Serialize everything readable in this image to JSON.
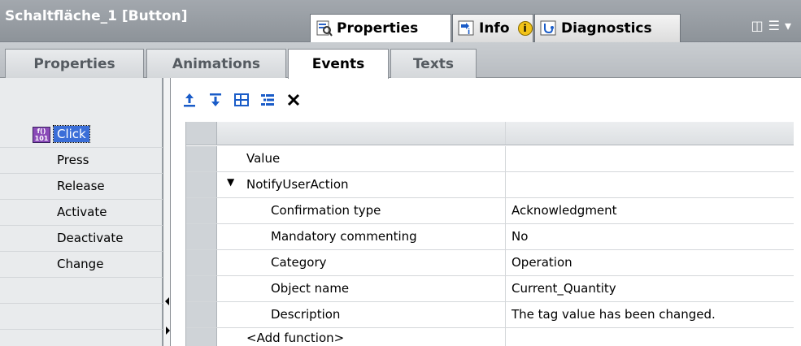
{
  "header": {
    "title": "Schaltfläche_1 [Button]",
    "tabs": [
      {
        "label": "Properties",
        "icon": "properties-icon"
      },
      {
        "label": "Info",
        "icon": "info-icon"
      },
      {
        "label": "Diagnostics",
        "icon": "diagnostics-icon"
      }
    ],
    "active_tab": "Properties"
  },
  "subtabs": [
    "Properties",
    "Animations",
    "Events",
    "Texts"
  ],
  "active_subtab": "Events",
  "events": [
    "Click",
    "Press",
    "Release",
    "Activate",
    "Deactivate",
    "Change"
  ],
  "selected_event": "Click",
  "toolbar": {
    "icons": [
      "move-up-icon",
      "move-down-icon",
      "collapse-all-icon",
      "expand-all-icon",
      "delete-icon"
    ]
  },
  "grid": {
    "rows": [
      {
        "name": "Value",
        "value": ""
      },
      {
        "name": "NotifyUserAction",
        "value": ""
      },
      {
        "name": "Confirmation type",
        "value": "Acknowledgment"
      },
      {
        "name": "Mandatory commenting",
        "value": "No"
      },
      {
        "name": "Category",
        "value": "Operation"
      },
      {
        "name": "Object name",
        "value": "Current_Quantity"
      },
      {
        "name": "Description",
        "value": "The tag value has been changed."
      },
      {
        "name": "<Add function>",
        "value": ""
      }
    ]
  },
  "colors": {
    "titlebar": "#8d9399",
    "selection": "#3a6ed8",
    "accent_icon": "#1a5cc8"
  }
}
